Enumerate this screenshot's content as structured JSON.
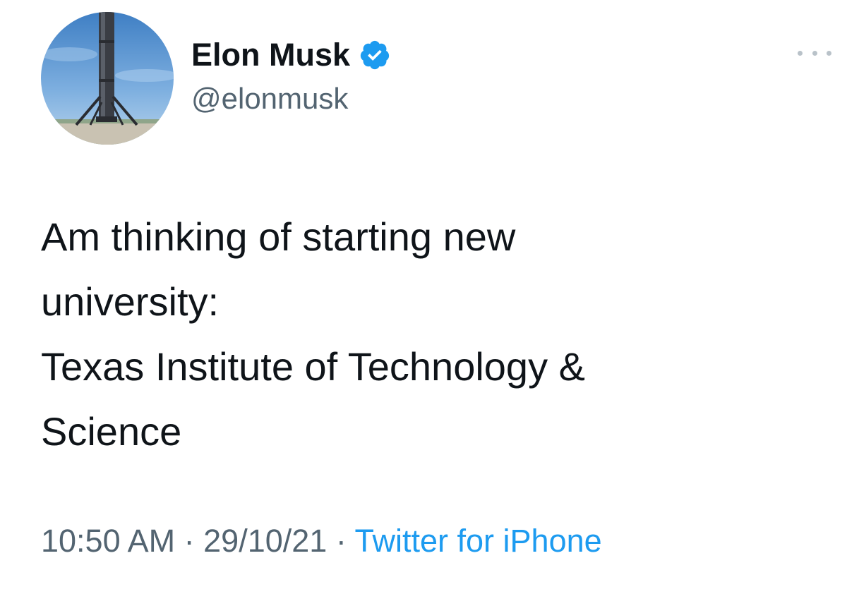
{
  "author": {
    "display_name": "Elon Musk",
    "handle": "@elonmusk",
    "verified": true,
    "avatar_icon": "rocket-booster-landed-avatar"
  },
  "tweet": {
    "lines": [
      "Am thinking of starting new",
      "university:",
      "Texas Institute of Technology &",
      "Science"
    ]
  },
  "meta": {
    "time": "10:50 AM",
    "separator": " · ",
    "date": "29/10/21",
    "source": "Twitter for iPhone"
  },
  "icons": {
    "verified": "verified-badge-icon",
    "more": "more-options-icon"
  },
  "colors": {
    "text": "#0f1419",
    "secondary": "#536471",
    "accent": "#1d9bf0"
  }
}
